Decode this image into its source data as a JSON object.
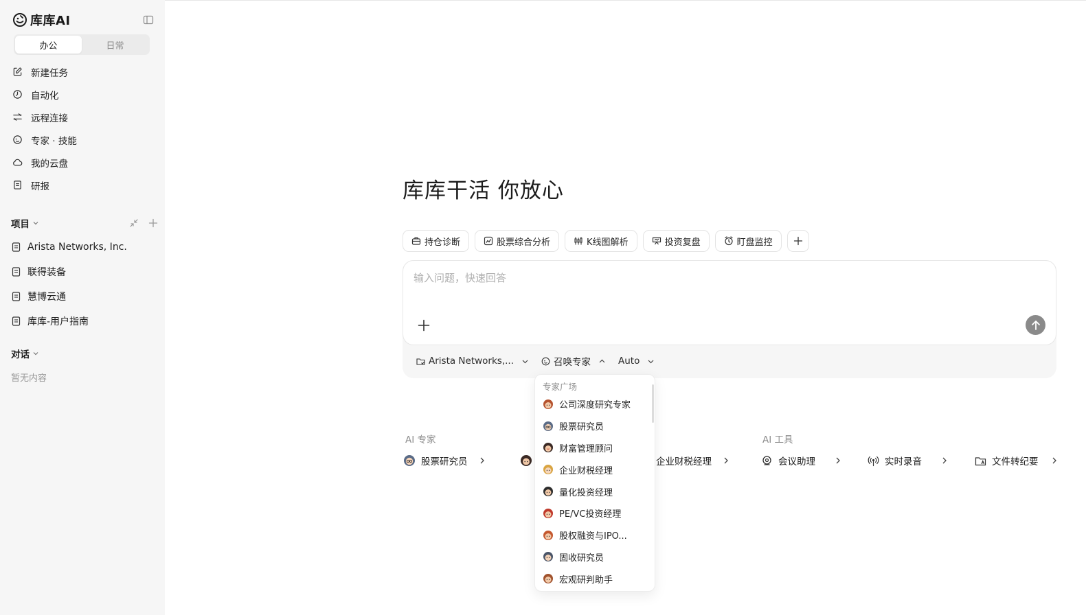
{
  "sidebar": {
    "brand": "库库AI",
    "tabs": [
      {
        "label": "办公",
        "active": true
      },
      {
        "label": "日常",
        "active": false
      }
    ],
    "nav": [
      {
        "label": "新建任务",
        "icon": "edit-icon"
      },
      {
        "label": "自动化",
        "icon": "clock-icon"
      },
      {
        "label": "远程连接",
        "icon": "remote-icon"
      },
      {
        "label": "专家 · 技能",
        "icon": "expert-icon"
      },
      {
        "label": "我的云盘",
        "icon": "cloud-icon"
      },
      {
        "label": "研报",
        "icon": "report-icon"
      }
    ],
    "projects": {
      "title": "项目",
      "items": [
        "Arista Networks, Inc.",
        "联得装备",
        "慧博云通",
        "库库-用户指南"
      ]
    },
    "conversations": {
      "title": "对话",
      "empty": "暂无内容"
    }
  },
  "main": {
    "headline": "库库干活 你放心",
    "chips": [
      {
        "label": "持仓诊断",
        "icon": "briefcase-icon"
      },
      {
        "label": "股票综合分析",
        "icon": "chart-icon"
      },
      {
        "label": "K线图解析",
        "icon": "candlestick-icon"
      },
      {
        "label": "投资复盘",
        "icon": "review-icon"
      },
      {
        "label": "盯盘监控",
        "icon": "alarm-icon"
      }
    ],
    "composer": {
      "placeholder": "输入问题，快速回答",
      "project": "Arista Networks,...",
      "expert": "召唤专家",
      "model": "Auto"
    },
    "dropdown": {
      "title": "专家广场",
      "items": [
        "公司深度研究专家",
        "股票研究员",
        "财富管理顾问",
        "企业财税经理",
        "量化投资经理",
        "PE/VC投资经理",
        "股权融资与IPO...",
        "固收研究员",
        "宏观研判助手"
      ]
    },
    "ai_experts": {
      "title": "AI 专家",
      "items": [
        "股票研究员",
        "企业财税经理"
      ]
    },
    "ai_tools": {
      "title": "AI 工具",
      "items": [
        "会议助理",
        "实时录音",
        "文件转纪要"
      ]
    }
  }
}
